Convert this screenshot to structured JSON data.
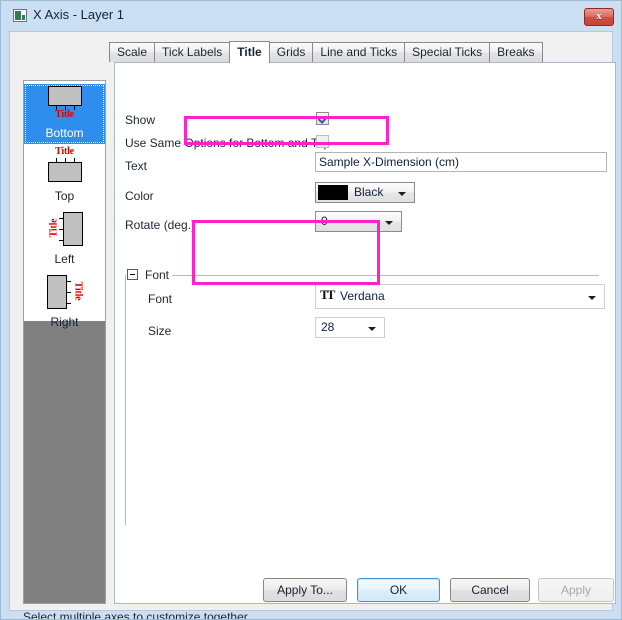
{
  "window": {
    "title": "X Axis - Layer 1",
    "icon": "axis-dialog-icon",
    "close_label": "x"
  },
  "tabs": [
    {
      "label": "Scale",
      "active": false
    },
    {
      "label": "Tick Labels",
      "active": false
    },
    {
      "label": "Title",
      "active": true
    },
    {
      "label": "Grids",
      "active": false
    },
    {
      "label": "Line and Ticks",
      "active": false
    },
    {
      "label": "Special Ticks",
      "active": false
    },
    {
      "label": "Breaks",
      "active": false
    }
  ],
  "axis_list": [
    {
      "label": "Bottom",
      "selected": true
    },
    {
      "label": "Top",
      "selected": false
    },
    {
      "label": "Left",
      "selected": false
    },
    {
      "label": "Right",
      "selected": false
    }
  ],
  "icon_title_text": "Title",
  "form": {
    "show": {
      "label": "Show",
      "checked": true
    },
    "same_options": {
      "label": "Use Same Options for Bottom and Top",
      "checked": false
    },
    "text": {
      "label": "Text",
      "value": "Sample X-Dimension (cm)",
      "placeholder": ""
    },
    "color": {
      "label": "Color",
      "value": "Black",
      "swatch": "#000000"
    },
    "rotate": {
      "label": "Rotate (deg.)",
      "value": "0"
    },
    "font_group": {
      "label": "Font"
    },
    "font": {
      "label": "Font",
      "value": "Verdana",
      "icon": "TT"
    },
    "size": {
      "label": "Size",
      "value": "28"
    }
  },
  "status": {
    "text": "Select multiple axes to customize together."
  },
  "buttons": {
    "apply_to": {
      "label": "Apply To...",
      "enabled": true
    },
    "ok": {
      "label": "OK",
      "enabled": true,
      "default": true
    },
    "cancel": {
      "label": "Cancel",
      "enabled": true
    },
    "apply": {
      "label": "Apply",
      "enabled": false
    }
  },
  "colors": {
    "highlight": "#ff22cc",
    "selection": "#2f8eed",
    "title_red": "#e00000"
  }
}
